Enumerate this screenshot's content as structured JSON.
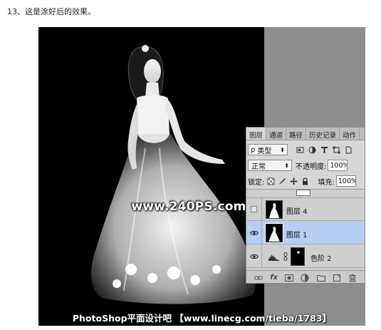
{
  "caption": "13、这是涂好后的效果。",
  "watermarks": {
    "center": "www.240PS.com",
    "bottom": "PhotoShop平面设计吧 【www.linecg.com/tieba/1783】"
  },
  "layers_panel": {
    "tabs": [
      {
        "label": "图层",
        "active": true
      },
      {
        "label": "通道",
        "active": false
      },
      {
        "label": "路径",
        "active": false
      },
      {
        "label": "历史记录",
        "active": false
      },
      {
        "label": "动作",
        "active": false
      }
    ],
    "filter": {
      "kind_label": "类型",
      "search_symbol": "ρ",
      "caret": "⬍"
    },
    "blend_mode": {
      "value": "正常",
      "caret": "⬍"
    },
    "opacity": {
      "label": "不透明度:",
      "value": "100%"
    },
    "lock": {
      "label": "锁定:"
    },
    "fill": {
      "label": "填充:",
      "value": "100%"
    },
    "layers": [
      {
        "name": "图层 4",
        "visible": false,
        "selected": false,
        "type": "pixel"
      },
      {
        "name": "图层 1",
        "visible": true,
        "selected": true,
        "type": "pixel"
      },
      {
        "name": "色阶 2",
        "visible": true,
        "selected": false,
        "type": "adjustment"
      }
    ],
    "footer_fx": "fx"
  },
  "colors": {
    "selected_row": "#b6cdf4",
    "panel_bg": "#d6d6d6",
    "canvas_bg": "#000000",
    "gray_area": "#8e8e8e"
  }
}
